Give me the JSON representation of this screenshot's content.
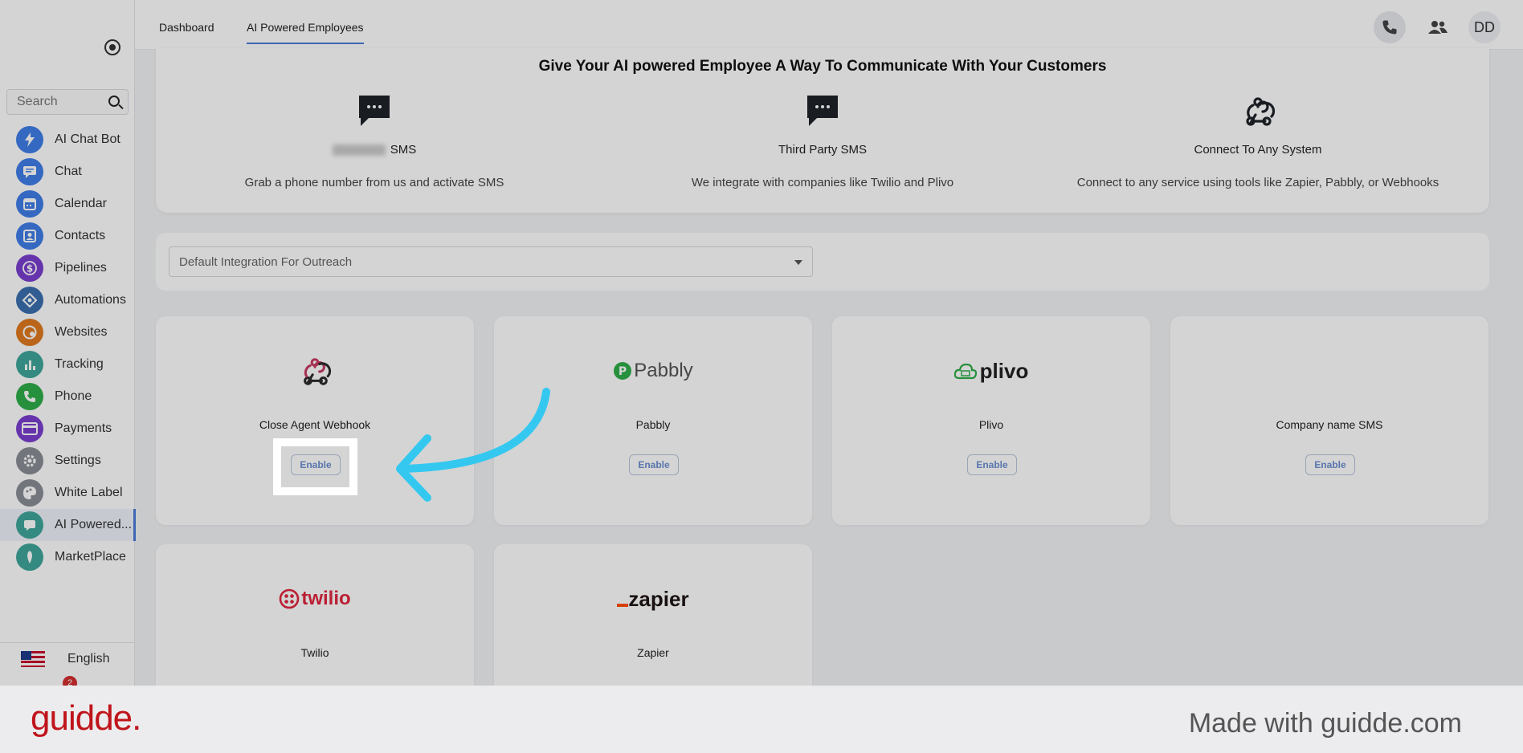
{
  "sidebar": {
    "search_placeholder": "Search",
    "items": [
      {
        "label": "AI Chat Bot",
        "icon": "lightning-icon",
        "color": "#3f7ee8"
      },
      {
        "label": "Chat",
        "icon": "chat-icon",
        "color": "#3f7ee8"
      },
      {
        "label": "Calendar",
        "icon": "calendar-icon",
        "color": "#3f7ee8"
      },
      {
        "label": "Contacts",
        "icon": "contacts-icon",
        "color": "#3f7ee8"
      },
      {
        "label": "Pipelines",
        "icon": "dollar-icon",
        "color": "#7a3fd1"
      },
      {
        "label": "Automations",
        "icon": "automation-icon",
        "color": "#3a6fb0"
      },
      {
        "label": "Websites",
        "icon": "globe-icon",
        "color": "#e07a1f"
      },
      {
        "label": "Tracking",
        "icon": "bar-chart-icon",
        "color": "#3fa69a"
      },
      {
        "label": "Phone",
        "icon": "phone-icon",
        "color": "#2fae4a"
      },
      {
        "label": "Payments",
        "icon": "card-icon",
        "color": "#7a3fd1"
      },
      {
        "label": "Settings",
        "icon": "gear-icon",
        "color": "#8a8f96"
      },
      {
        "label": "White Label",
        "icon": "palette-icon",
        "color": "#8a8f96"
      },
      {
        "label": "AI Powered...",
        "icon": "chat-bubble-icon",
        "color": "#3fa69a"
      },
      {
        "label": "MarketPlace",
        "icon": "marketplace-icon",
        "color": "#3fa69a"
      }
    ],
    "language": "English",
    "notification_count": "2"
  },
  "header": {
    "tabs": [
      {
        "label": "Dashboard"
      },
      {
        "label": "AI Powered Employees"
      }
    ],
    "avatar_initials": "DD"
  },
  "communicate": {
    "title": "Give Your AI powered Employee A Way To Communicate With Your Customers",
    "options": [
      {
        "title": "SMS",
        "desc": "Grab a phone number from us and activate SMS"
      },
      {
        "title": "Third Party SMS",
        "desc": "We integrate with companies like Twilio and Plivo"
      },
      {
        "title": "Connect To Any System",
        "desc": "Connect to any service using tools like Zapier, Pabbly, or Webhooks"
      }
    ]
  },
  "dropdown": {
    "value": "Default Integration For Outreach"
  },
  "integrations": [
    {
      "name": "Close Agent Webhook",
      "enable": "Enable"
    },
    {
      "name": "Pabbly",
      "logo": "Pabbly",
      "enable": "Enable"
    },
    {
      "name": "Plivo",
      "logo": "plivo",
      "enable": "Enable"
    },
    {
      "name": "Company name SMS",
      "enable": "Enable"
    },
    {
      "name": "Twilio",
      "logo": "twilio"
    },
    {
      "name": "Zapier",
      "logo": "zapier"
    }
  ],
  "footer": {
    "brand": "guidde.",
    "made_with": "Made with guidde.com"
  },
  "colors": {
    "accent": "#4b7bd8",
    "arrow": "#34c8f0",
    "brand": "#c0141b"
  }
}
